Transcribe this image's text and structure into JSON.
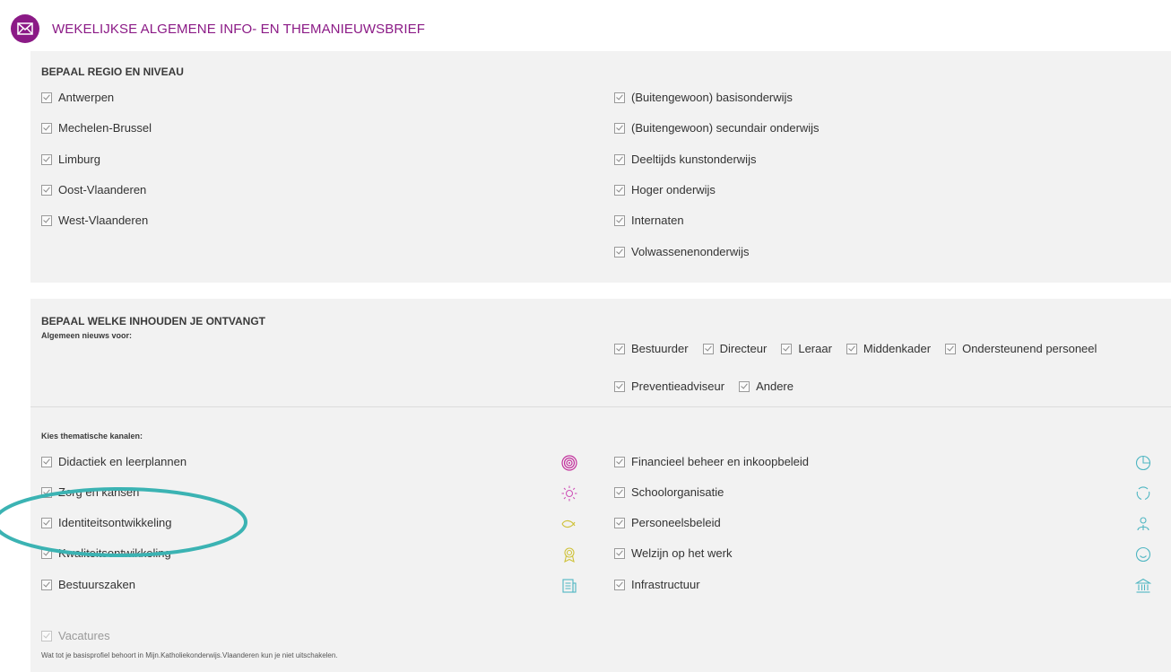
{
  "header": {
    "title": "WEKELIJKSE ALGEMENE INFO- EN THEMANIEUWSBRIEF",
    "icon": "mail-icon"
  },
  "region": {
    "title": "BEPAAL REGIO EN NIVEAU",
    "regions": [
      "Antwerpen",
      "Mechelen-Brussel",
      "Limburg",
      "Oost-Vlaanderen",
      "West-Vlaanderen"
    ],
    "levels": [
      "(Buitengewoon) basisonderwijs",
      "(Buitengewoon) secundair onderwijs",
      "Deeltijds kunstonderwijs",
      "Hoger onderwijs",
      "Internaten",
      "Volwassenenonderwijs"
    ]
  },
  "content": {
    "title": "BEPAAL WELKE INHOUDEN JE ONTVANGT",
    "general_label": "Algemeen nieuws voor:",
    "audiences_row1": [
      "Bestuurder",
      "Directeur",
      "Leraar",
      "Middenkader",
      "Ondersteunend personeel"
    ],
    "audiences_row2": [
      "Preventieadviseur",
      "Andere"
    ],
    "channels_label": "Kies thematische kanalen:",
    "channels_left": [
      {
        "label": "Didactiek en leerplannen",
        "icon": "target-icon"
      },
      {
        "label": "Zorg en kansen",
        "icon": "sun-icon"
      },
      {
        "label": "Identiteitsontwikkeling",
        "icon": "fish-icon"
      },
      {
        "label": "Kwaliteitsontwikkeling",
        "icon": "award-icon"
      },
      {
        "label": "Bestuurszaken",
        "icon": "document-icon"
      }
    ],
    "channels_right": [
      {
        "label": "Financieel beheer en inkoopbeleid",
        "icon": "pie-chart-icon"
      },
      {
        "label": "Schoolorganisatie",
        "icon": "cycle-icon"
      },
      {
        "label": "Personeelsbeleid",
        "icon": "people-icon"
      },
      {
        "label": "Welzijn op het werk",
        "icon": "smiley-icon"
      },
      {
        "label": "Infrastructuur",
        "icon": "building-icon"
      }
    ],
    "vacatures": "Vacatures",
    "note": "Wat tot je basisprofiel behoort in Mijn.Katholiekonderwijs.Vlaanderen kun je niet uitschakelen."
  },
  "colors": {
    "brand": "#8b1a86",
    "icon_pink": "#c2309c",
    "icon_yellow": "#cfc23a",
    "icon_teal": "#4fb6c2",
    "annotation": "#3bb3b3"
  }
}
